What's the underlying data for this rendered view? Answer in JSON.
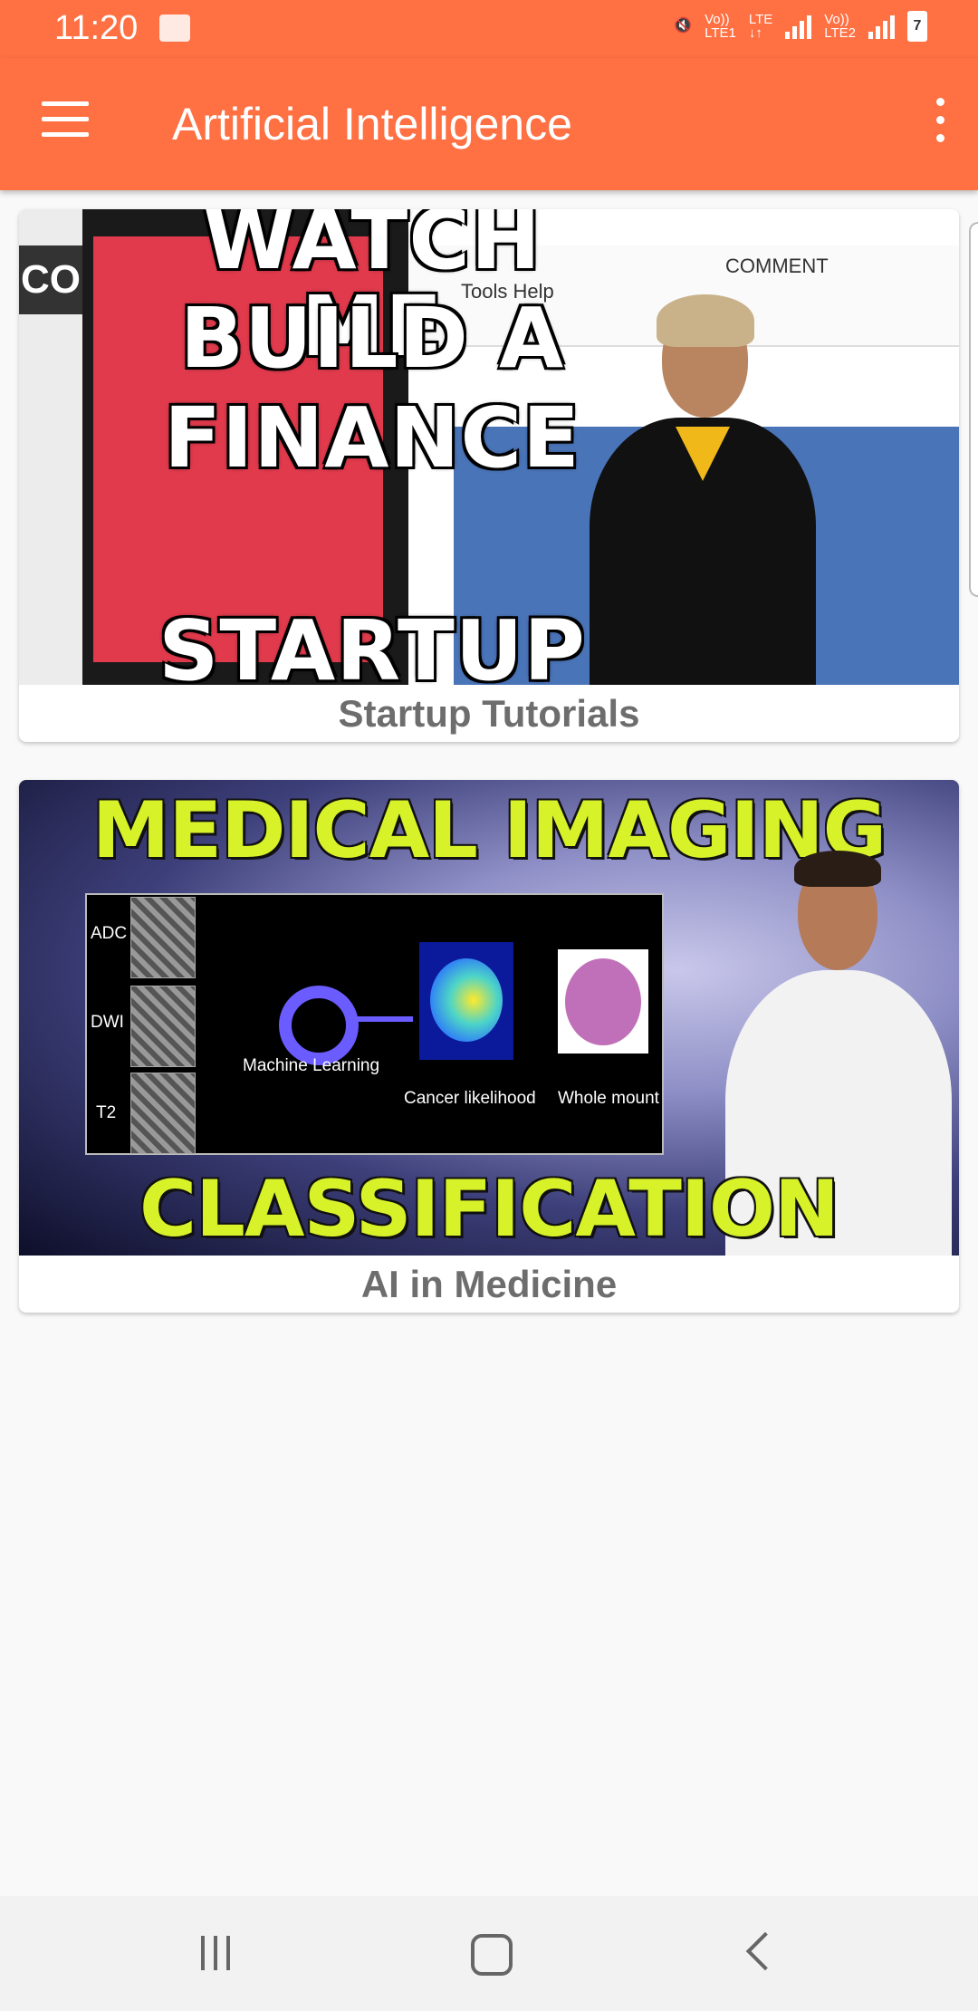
{
  "status_bar": {
    "time": "11:20",
    "sim1": [
      "Vo))",
      "LTE1"
    ],
    "lte": [
      "LTE",
      "↓↑"
    ],
    "sim2": [
      "Vo))",
      "LTE2"
    ],
    "battery": "7"
  },
  "app_bar": {
    "title": "Artificial Intelligence",
    "menu_icon": "hamburger-menu-icon",
    "overflow_icon": "more-vert-icon"
  },
  "cards": [
    {
      "label": "Startup Tutorials",
      "thumb": {
        "lines": [
          "WATCH ME",
          "BUILD A",
          "FINANCE",
          "STARTUP"
        ],
        "side_text": "CO",
        "toolbar_comment": "COMMENT",
        "toolbar_tools": "Tools    Help"
      }
    },
    {
      "label": "AI in Medicine",
      "thumb": {
        "top_title": "MEDICAL IMAGING",
        "bottom_title": "CLASSIFICATION",
        "row_labels": [
          "ADC",
          "DWI",
          "T2"
        ],
        "ml_label": "Machine Learning",
        "cancer_label": "Cancer likelihood",
        "whole_label": "Whole mount"
      }
    }
  ],
  "nav": {
    "recent_icon": "recent-apps-icon",
    "home_icon": "home-icon",
    "back_icon": "back-icon"
  },
  "colors": {
    "primary": "#ff7043",
    "label_text": "#6d6d6d",
    "background": "#f9f9f9"
  }
}
